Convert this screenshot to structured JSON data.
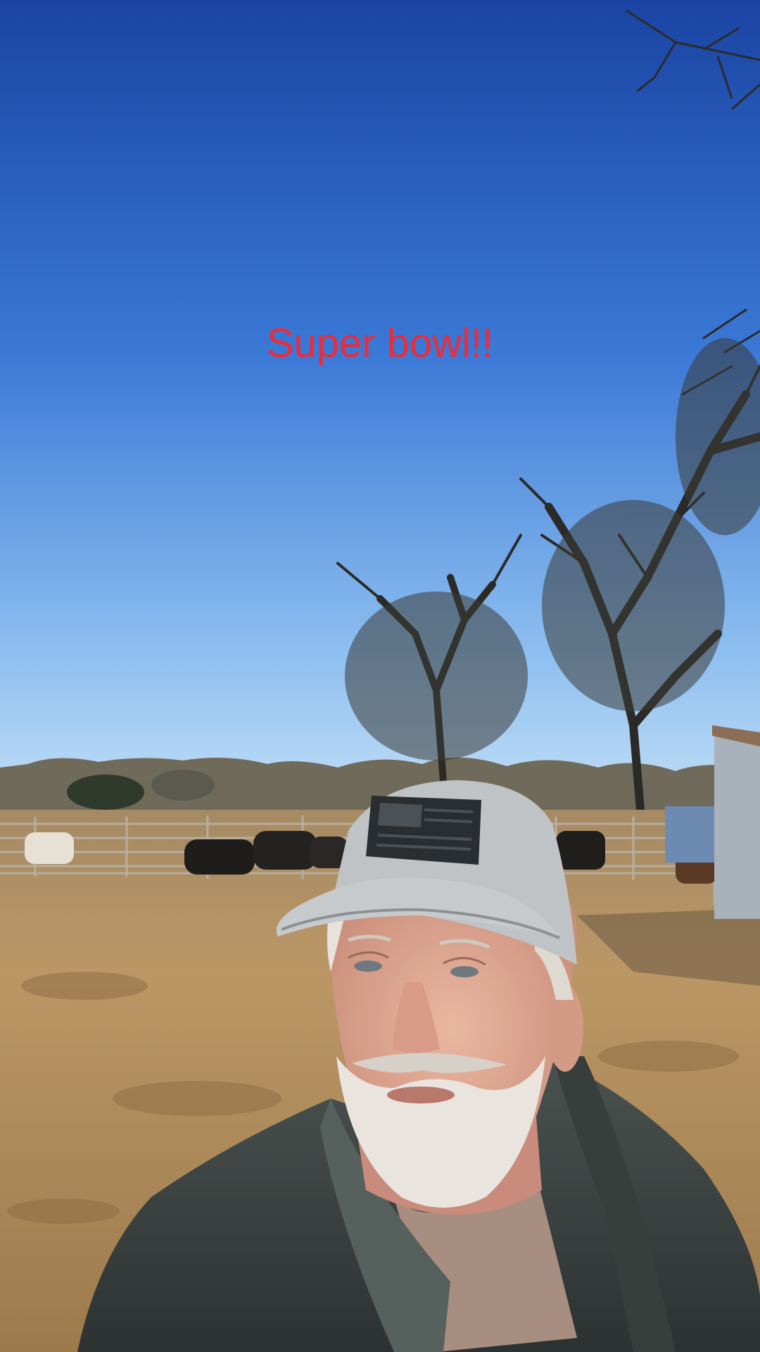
{
  "caption": {
    "text": "Super bowl!!",
    "color": "#ec2c3a"
  },
  "scene": {
    "sky_top": "#1d4aa8",
    "sky_bottom": "#a8d0f4",
    "grass": "#b89462",
    "jacket": "#3b4342",
    "cap_front": "#bfc3c6",
    "cap_mesh": "#1c1c1c",
    "patch": "#2c3034",
    "skin": "#e2ad98"
  }
}
